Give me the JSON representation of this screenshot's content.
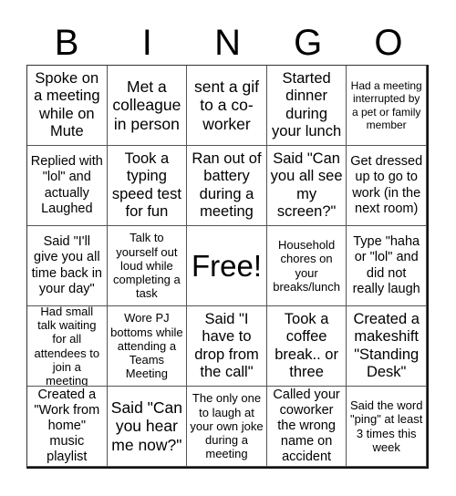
{
  "header": {
    "letters": [
      "B",
      "I",
      "N",
      "G",
      "O"
    ]
  },
  "board": {
    "rows": [
      [
        "Spoke on a meeting while on Mute",
        "Met a colleague in person",
        "sent a gif to a co-worker",
        "Started dinner during your lunch",
        "Had a meeting interrupted by a pet or family member"
      ],
      [
        "Replied with \"lol\" and actually Laughed",
        "Took a typing speed test for fun",
        "Ran out of battery during a meeting",
        "Said \"Can you all see my screen?\"",
        "Get dressed up to go to work (in the next room)"
      ],
      [
        "Said \"I'll give you all time back in your day\"",
        "Talk to yourself out loud while completing a task",
        "Free!",
        "Household chores on your breaks/lunch",
        "Type \"haha or \"lol\" and did not really laugh"
      ],
      [
        "Had small talk waiting for all attendees to join a meeting",
        "Wore PJ bottoms while attending a Teams Meeting",
        "Said \"I have to drop from the call\"",
        "Took a coffee break.. or three",
        "Created a makeshift \"Standing Desk\""
      ],
      [
        "Created a \"Work from home\" music playlist",
        "Said \"Can you hear me now?\"",
        "The only one to laugh at your own joke during a meeting",
        "Called your coworker the wrong name on accident",
        "Said the word \"ping\" at least 3 times this week"
      ]
    ]
  }
}
